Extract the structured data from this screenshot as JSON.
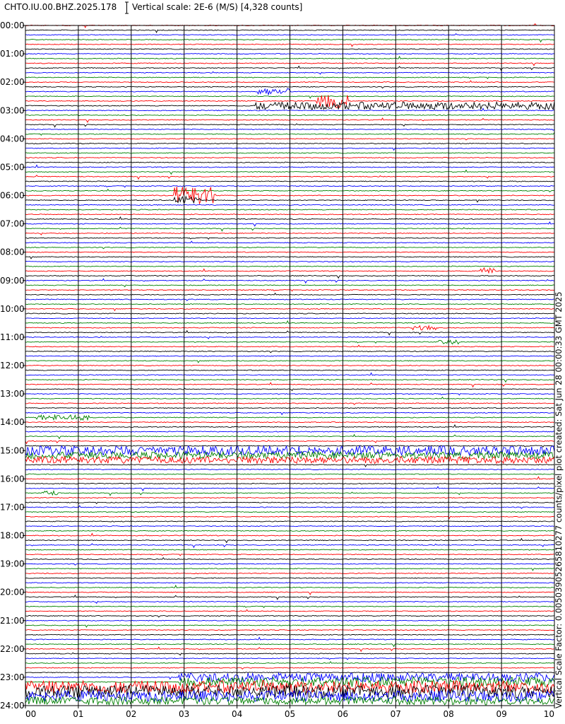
{
  "header": {
    "station": "CHTO.IU.00.BHZ.2025.178",
    "vertical_scale": "Vertical scale: 2E-6 (M/S) [4,328 counts]"
  },
  "side_label": "Vertical Scale Factor: 0.00503905265810277 counts/pixel plot created: Sat Jun 28 00:00:33 GMT 2025",
  "colors": {
    "trace_cycle": [
      "#ff0000",
      "#000000",
      "#0000ff",
      "#008000"
    ],
    "frame": "#000000",
    "background": "#ffffff"
  },
  "chart_data": {
    "type": "seismogram",
    "title": "CHTO.IU.00.BHZ.2025.178",
    "xlabel": "",
    "ylabel": "",
    "x_ticks": [
      "00",
      "01",
      "02",
      "03",
      "04",
      "05",
      "06",
      "07",
      "08",
      "09",
      "10"
    ],
    "y_ticks": [
      "00:00",
      "01:00",
      "02:00",
      "03:00",
      "04:00",
      "05:00",
      "06:00",
      "07:00",
      "08:00",
      "09:00",
      "10:00",
      "11:00",
      "12:00",
      "13:00",
      "14:00",
      "15:00",
      "16:00",
      "17:00",
      "18:00",
      "19:00",
      "20:00",
      "21:00",
      "22:00",
      "23:00",
      "24:00"
    ],
    "x_range_minutes": [
      0,
      10
    ],
    "y_range_hours": [
      0,
      24
    ],
    "lines_per_hour": 6,
    "grid": "vertical",
    "events": [
      {
        "row": 14,
        "start_min": 4.4,
        "end_min": 5.0,
        "amplitude": 2.2
      },
      {
        "row": 16,
        "start_min": 5.5,
        "end_min": 6.1,
        "amplitude": 5
      },
      {
        "row": 17,
        "start_min": 4.3,
        "end_min": 10,
        "amplitude": 2.4
      },
      {
        "row": 36,
        "start_min": 2.8,
        "end_min": 3.6,
        "amplitude": 6
      },
      {
        "row": 37,
        "start_min": 2.8,
        "end_min": 3.3,
        "amplitude": 2.5
      },
      {
        "row": 52,
        "start_min": 8.6,
        "end_min": 8.9,
        "amplitude": 2
      },
      {
        "row": 64,
        "start_min": 7.3,
        "end_min": 7.8,
        "amplitude": 1.4
      },
      {
        "row": 67,
        "start_min": 7.8,
        "end_min": 8.2,
        "amplitude": 1.4
      },
      {
        "row": 83,
        "start_min": 0.2,
        "end_min": 1.2,
        "amplitude": 1.8
      },
      {
        "row": 90,
        "start_min": 0,
        "end_min": 10,
        "amplitude": 3
      },
      {
        "row": 91,
        "start_min": 0,
        "end_min": 10,
        "amplitude": 2.2
      },
      {
        "row": 92,
        "start_min": 0,
        "end_min": 10,
        "amplitude": 2.2
      },
      {
        "row": 99,
        "start_min": 0.3,
        "end_min": 0.6,
        "amplitude": 1.6
      },
      {
        "row": 138,
        "start_min": 2.9,
        "end_min": 10,
        "amplitude": 2.8
      },
      {
        "row": 139,
        "start_min": 2.9,
        "end_min": 10,
        "amplitude": 3.2
      },
      {
        "row": 140,
        "start_min": 0,
        "end_min": 10,
        "amplitude": 4
      },
      {
        "row": 141,
        "start_min": 0,
        "end_min": 10,
        "amplitude": 4
      },
      {
        "row": 142,
        "start_min": 0,
        "end_min": 10,
        "amplitude": 3.5
      },
      {
        "row": 143,
        "start_min": 0,
        "end_min": 10,
        "amplitude": 2.5
      }
    ]
  }
}
